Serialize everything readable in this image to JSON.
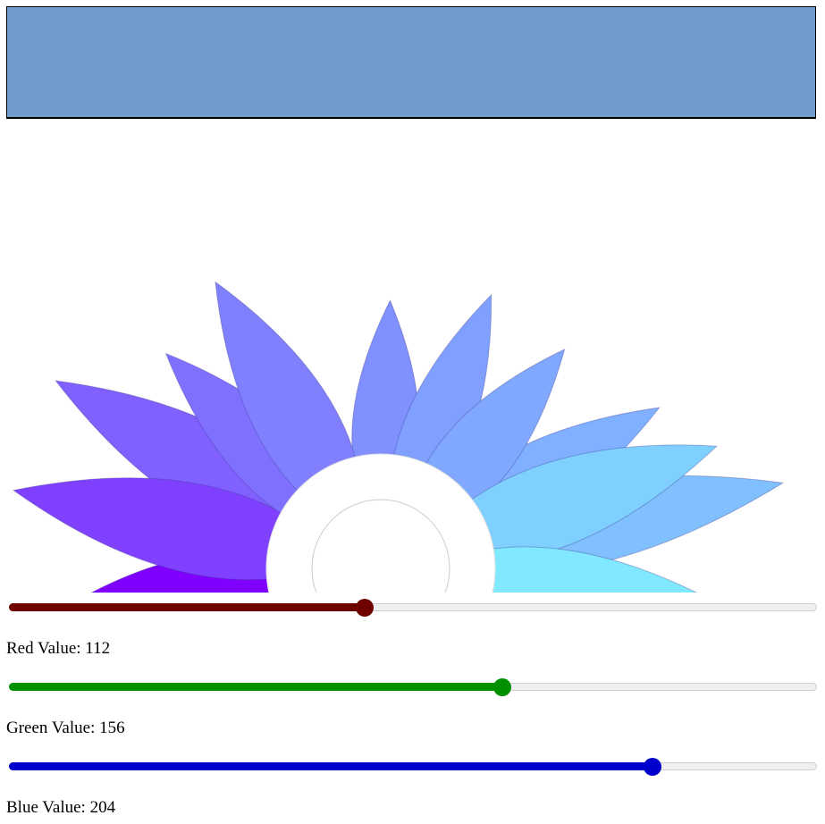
{
  "color": {
    "red": 112,
    "green": 156,
    "blue": 204
  },
  "sliders": [
    {
      "id": "red",
      "label": "Red Value: 112",
      "value": 112,
      "max": 255,
      "color": "#6f0000"
    },
    {
      "id": "green",
      "label": "Green Value: 156",
      "value": 156,
      "max": 255,
      "color": "#009000"
    },
    {
      "id": "blue",
      "label": "Blue Value: 204",
      "value": 204,
      "max": 255,
      "color": "#0000cc"
    }
  ],
  "flower": {
    "petal_colors": [
      "#8000ff",
      "#8040ff",
      "#8060ff",
      "#8070ff",
      "#8080ff",
      "#8090ff",
      "#80a0ff",
      "#80a8ff",
      "#80b0ff",
      "#80c0ff",
      "#80d0ff",
      "#80e8ff"
    ],
    "center_color": "#ffffff"
  }
}
